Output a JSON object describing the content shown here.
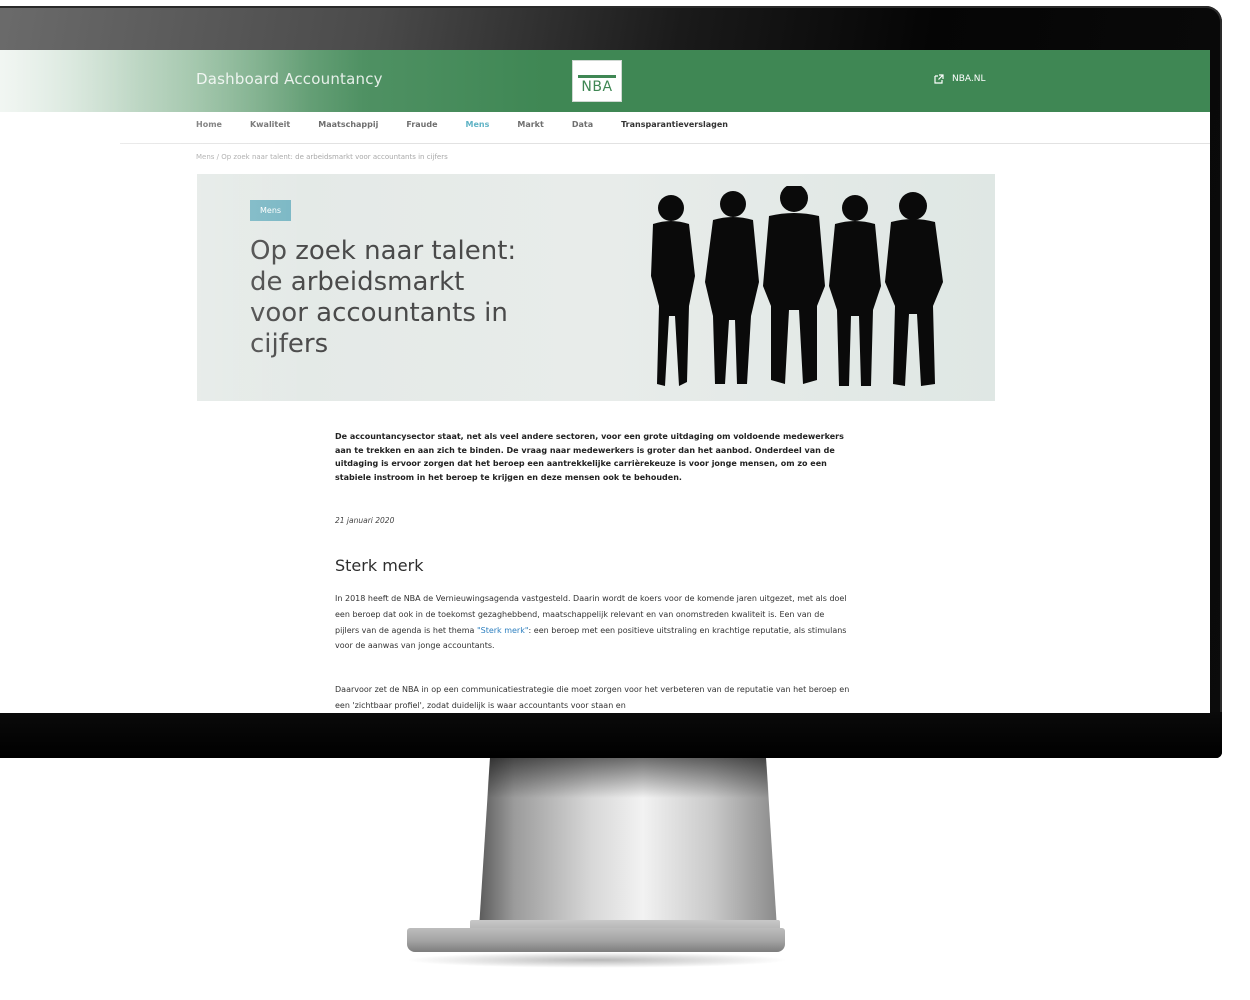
{
  "site": {
    "title": "Dashboard Accountancy",
    "logo_text": "NBA",
    "external_link": "NBA.NL"
  },
  "nav": {
    "items": [
      "Home",
      "Kwaliteit",
      "Maatschappij",
      "Fraude",
      "Mens",
      "Markt",
      "Data",
      "Transparantieverslagen"
    ],
    "active": "Mens"
  },
  "breadcrumb": "Mens / Op zoek naar talent: de arbeidsmarkt voor accountants in cijfers",
  "hero": {
    "tag": "Mens",
    "title_lines": [
      "Op zoek naar talent:",
      "de arbeidsmarkt",
      "voor accountants in",
      "cijfers"
    ]
  },
  "article": {
    "lead": "De accountancysector staat, net als veel andere sectoren, voor een grote uitdaging om voldoende medewerkers aan te trekken en aan zich te binden. De vraag naar medewerkers is groter dan het aanbod. Onderdeel van de uitdaging is ervoor zorgen dat het beroep een aantrekkelijke carrièrekeuze is voor jonge mensen, om zo een stabiele instroom in het beroep te krijgen en deze mensen ook te behouden.",
    "date": "21 januari 2020",
    "section_title": "Sterk merk",
    "para1_before": "In 2018 heeft de NBA de Vernieuwingsagenda vastgesteld. Daarin wordt de koers voor de komende jaren uitgezet, met als doel een beroep dat ook in de toekomst gezaghebbend, maatschappelijk relevant en van onomstreden kwaliteit is. Een van de pijlers van de agenda is het thema ",
    "para1_link": "\"Sterk merk\"",
    "para1_after": ": een beroep met een positieve uitstraling en krachtige reputatie, als stimulans voor de aanwas van jonge accountants.",
    "para2": "Daarvoor zet de NBA in op een communicatiestrategie die moet zorgen voor het verbeteren van de reputatie van het beroep en een 'zichtbaar profiel', zodat duidelijk is waar accountants voor staan en"
  },
  "colors": {
    "header_green": "#3f8754",
    "tag_blue": "#7ab7c4",
    "link_blue": "#2d7fbf"
  }
}
